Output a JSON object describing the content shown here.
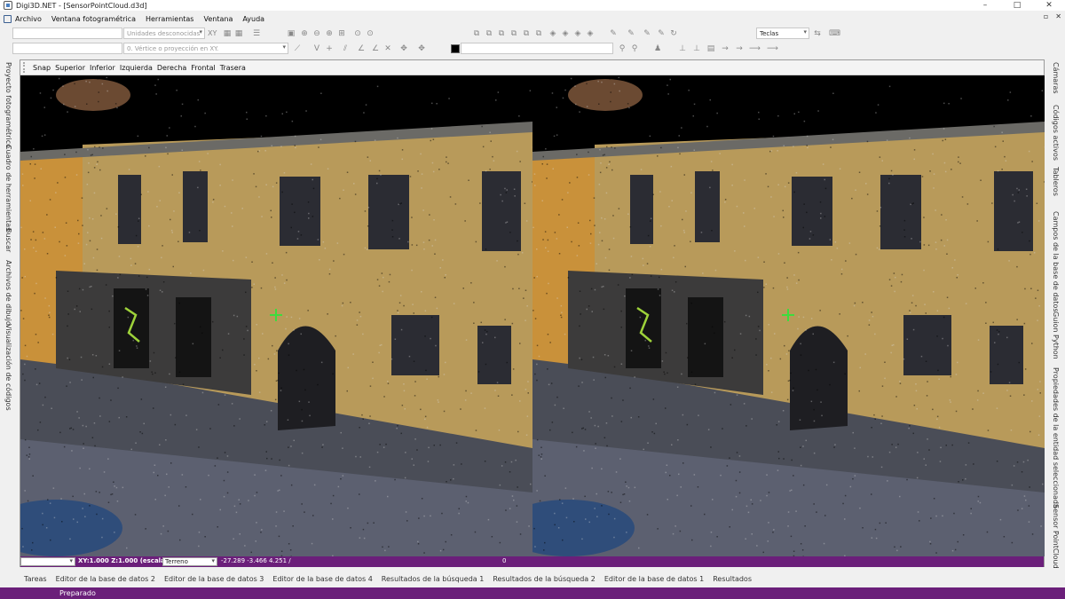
{
  "window": {
    "title": "Digi3D.NET - [SensorPointCloud.d3d]",
    "controls": [
      "–",
      "□",
      "✕"
    ]
  },
  "menu": {
    "items": [
      "Archivo",
      "Ventana fotogramétrica",
      "Herramientas",
      "Ventana",
      "Ayuda"
    ],
    "mdi_controls": [
      "▫",
      "✕"
    ]
  },
  "toolbar": {
    "units_placeholder": "Unidades desconocidas",
    "xy_label": "XY",
    "vertex_placeholder": "0. Vértice o proyección en XY.",
    "keys_select": "Teclas"
  },
  "left_dock": {
    "tabs": [
      "Proyecto fotogramétrico",
      "Cuadro de herramientas",
      "Buscar",
      "Archivos de dibujo",
      "Visualización de códigos"
    ]
  },
  "right_dock": {
    "tabs": [
      "Cámaras",
      "Códigos activos",
      "Tableros",
      "Campos de la base de datos",
      "Guion Python",
      "Propiedades de la entidad seleccionada",
      "Sensor PointCloud"
    ]
  },
  "view_toolbar": {
    "items": [
      "Snap",
      "Superior",
      "Inferior",
      "Izquierda",
      "Derecha",
      "Frontal",
      "Trasera"
    ]
  },
  "coord_bar": {
    "scale": "XY:1.000 Z:1.000 (escalado)",
    "mode_select": "Terreno",
    "coordinates": "-27.289 -3.466 4.251 /",
    "value": "0"
  },
  "bottom_tabs": {
    "items": [
      "Tareas",
      "Editor de la base de datos 2",
      "Editor de la base de datos 3",
      "Editor de la base de datos 4",
      "Resultados de la búsqueda 1",
      "Resultados de la búsqueda 2",
      "Editor de la base de datos 1",
      "Resultados"
    ]
  },
  "status": {
    "text": "Preparado"
  },
  "colors": {
    "accent": "#6b1f7a",
    "cursor": "#3ddc3d",
    "facade": "#b89a5a"
  },
  "icons": {
    "app": "app-icon",
    "cursor": "crosshair-cursor-icon"
  }
}
